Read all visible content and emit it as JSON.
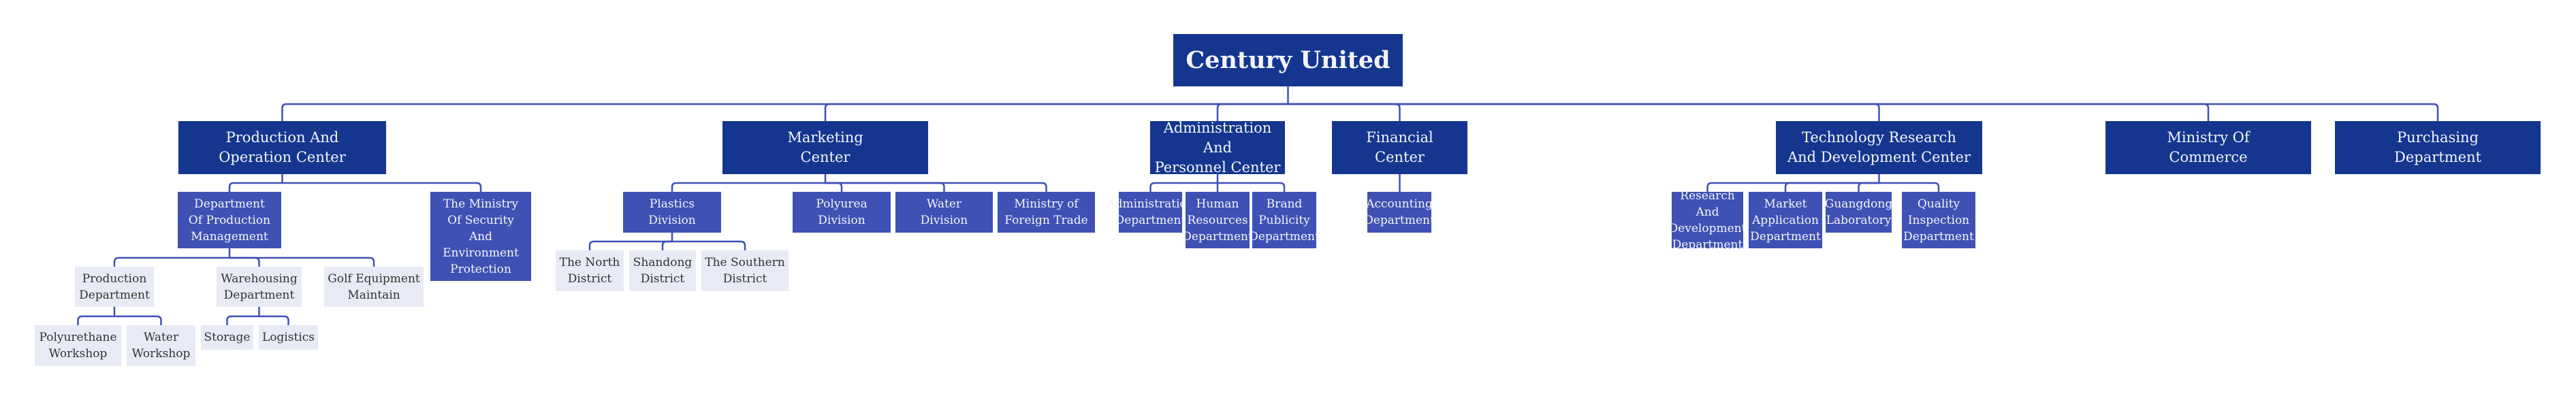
{
  "title": "Century United",
  "colors": {
    "root": "#14368f",
    "level1": "#14368f",
    "level2": "#3f51b5",
    "level3": "#e8ebf5",
    "connector": "#3f51b5",
    "text_light": "#f4f4f8",
    "text_dark": "#333333"
  },
  "nodes": {
    "root": {
      "label": "Century United"
    },
    "production": {
      "label": "Production And\nOperation Center"
    },
    "dept_prod_mgmt": {
      "label": "Department\nOf Production\nManagement"
    },
    "production_dept": {
      "label": "Production\nDepartment"
    },
    "polyurethane_workshop": {
      "label": "Polyurethane\nWorkshop"
    },
    "water_workshop": {
      "label": "Water\nWorkshop"
    },
    "warehousing_dept": {
      "label": "Warehousing\nDepartment"
    },
    "storage": {
      "label": "Storage"
    },
    "logistics": {
      "label": "Logistics"
    },
    "golf_equipment": {
      "label": "Golf Equipment\nMaintain"
    },
    "ministry_security": {
      "label": "The Ministry\nOf Security\nAnd\nEnvironment\nProtection"
    },
    "marketing": {
      "label": "Marketing\nCenter"
    },
    "plastics_division": {
      "label": "Plastics\nDivision"
    },
    "north_district": {
      "label": "The North\nDistrict"
    },
    "shandong_district": {
      "label": "Shandong\nDistrict"
    },
    "southern_district": {
      "label": "The Southern\nDistrict"
    },
    "polyurea_division": {
      "label": "Polyurea\nDivision"
    },
    "water_division": {
      "label": "Water\nDivision"
    },
    "foreign_trade": {
      "label": "Ministry of\nForeign Trade"
    },
    "admin_center": {
      "label": "Administration And\nPersonnel Center"
    },
    "admin_dept": {
      "label": "Administration\nDepartment"
    },
    "hr_dept": {
      "label": "Human\nResources\nDepartment"
    },
    "brand_dept": {
      "label": "Brand\nPublicity\nDepartment"
    },
    "financial_center": {
      "label": "Financial\nCenter"
    },
    "accounting_dept": {
      "label": "Accounting\nDepartment"
    },
    "tech_center": {
      "label": "Technology Research\nAnd Development Center"
    },
    "rnd_dept": {
      "label": "Research And\nDevelopment\nDepartment"
    },
    "market_app_dept": {
      "label": "Market\nApplication\nDepartment"
    },
    "guangdong_lab": {
      "label": "Guangdong\nLaboratory"
    },
    "quality_dept": {
      "label": "Quality\nInspection\nDepartment"
    },
    "commerce": {
      "label": "Ministry Of\nCommerce"
    },
    "purchasing": {
      "label": "Purchasing\nDepartment"
    }
  },
  "tree": {
    "root": [
      "production",
      "marketing",
      "admin_center",
      "financial_center",
      "tech_center",
      "commerce",
      "purchasing"
    ],
    "production": [
      "dept_prod_mgmt",
      "ministry_security"
    ],
    "dept_prod_mgmt": [
      "production_dept",
      "warehousing_dept",
      "golf_equipment"
    ],
    "production_dept": [
      "polyurethane_workshop",
      "water_workshop"
    ],
    "warehousing_dept": [
      "storage",
      "logistics"
    ],
    "marketing": [
      "plastics_division",
      "polyurea_division",
      "water_division",
      "foreign_trade"
    ],
    "plastics_division": [
      "north_district",
      "shandong_district",
      "southern_district"
    ],
    "admin_center": [
      "admin_dept",
      "hr_dept",
      "brand_dept"
    ],
    "financial_center": [
      "accounting_dept"
    ],
    "tech_center": [
      "rnd_dept",
      "market_app_dept",
      "guangdong_lab",
      "quality_dept"
    ]
  }
}
